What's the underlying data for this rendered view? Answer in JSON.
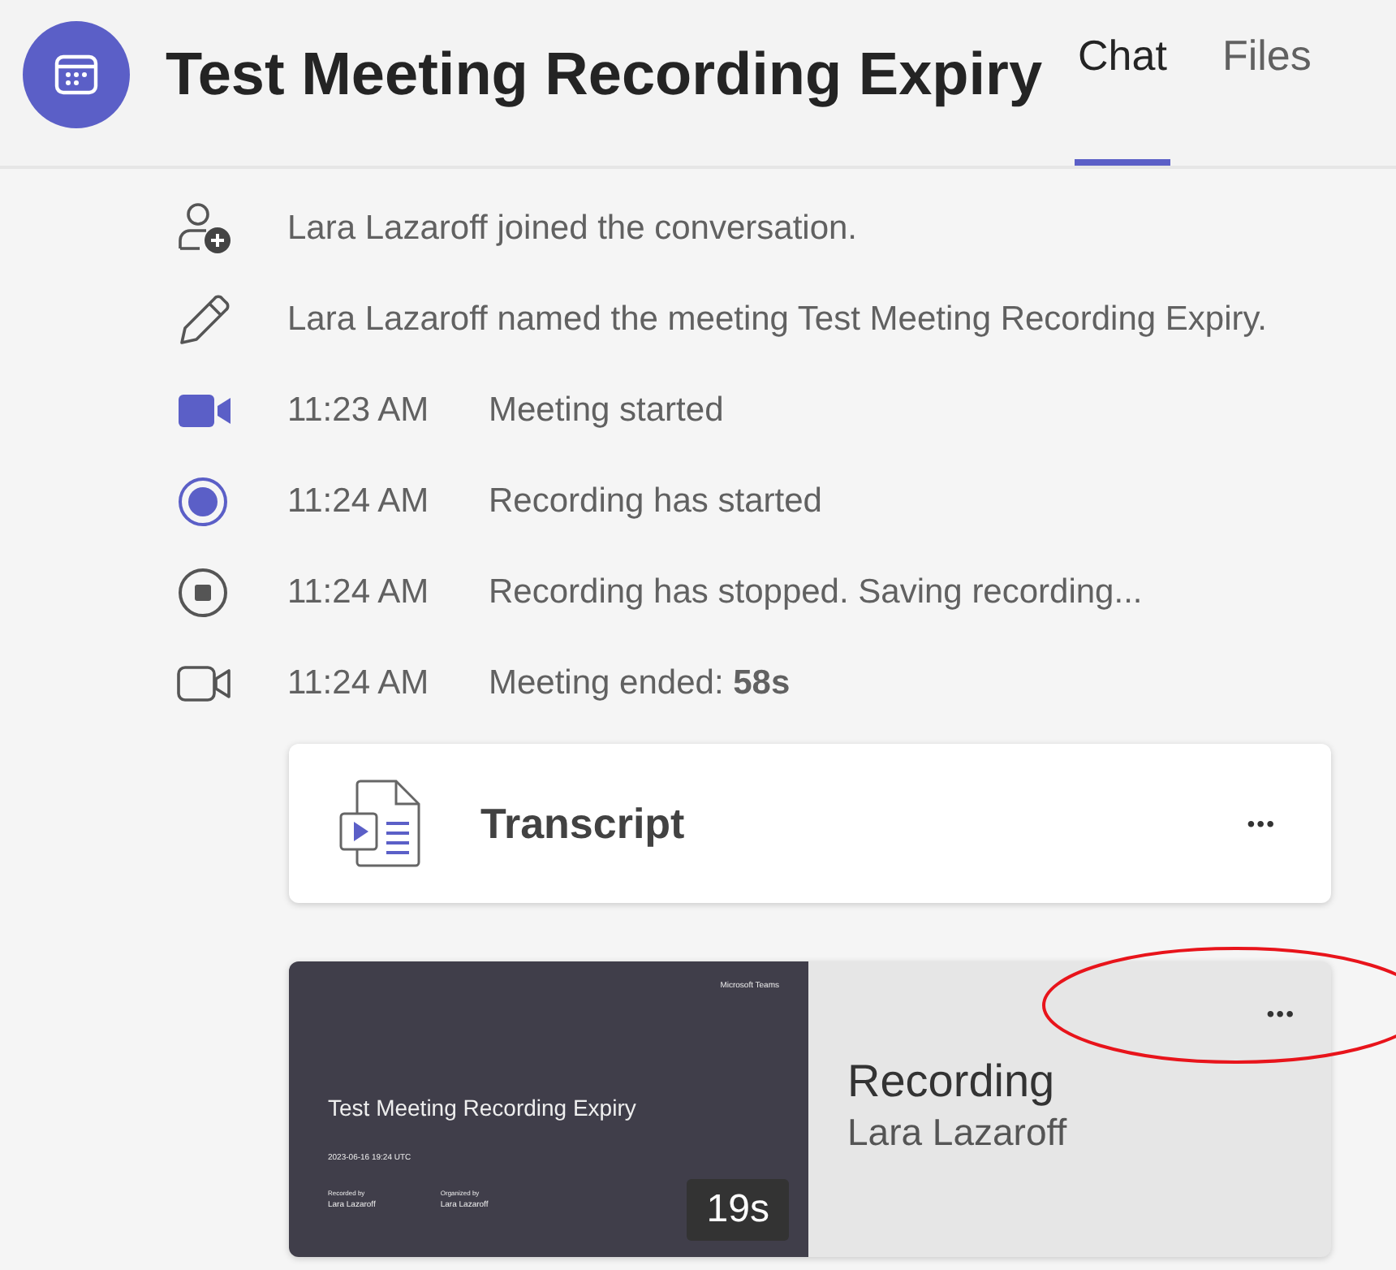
{
  "header": {
    "title": "Test Meeting Recording Expiry",
    "tabs": [
      {
        "label": "Chat",
        "selected": true
      },
      {
        "label": "Files",
        "selected": false
      }
    ]
  },
  "events": [
    {
      "kind": "joined",
      "text": "Lara Lazaroff joined the conversation."
    },
    {
      "kind": "renamed",
      "text": "Lara Lazaroff named the meeting Test Meeting Recording Expiry."
    },
    {
      "kind": "meeting-start",
      "time": "11:23 AM",
      "text": "Meeting started"
    },
    {
      "kind": "record-start",
      "time": "11:24 AM",
      "text": "Recording has started"
    },
    {
      "kind": "record-stop",
      "time": "11:24 AM",
      "text": "Recording has stopped. Saving recording..."
    },
    {
      "kind": "meeting-end",
      "time": "11:24 AM",
      "text": "Meeting ended: **58s**"
    }
  ],
  "transcript_card": {
    "title": "Transcript",
    "more": "•••"
  },
  "recording_card": {
    "thumbnail": {
      "brand": "Microsoft Teams",
      "title": "Test Meeting Recording Expiry",
      "date": "2023-06-16 19:24 UTC",
      "people": [
        {
          "role": "Recorded by",
          "name": "Lara Lazaroff"
        },
        {
          "role": "Organized by",
          "name": "Lara Lazaroff"
        }
      ],
      "duration": "19s"
    },
    "title": "Recording",
    "author": "Lara Lazaroff",
    "more": "•••"
  }
}
